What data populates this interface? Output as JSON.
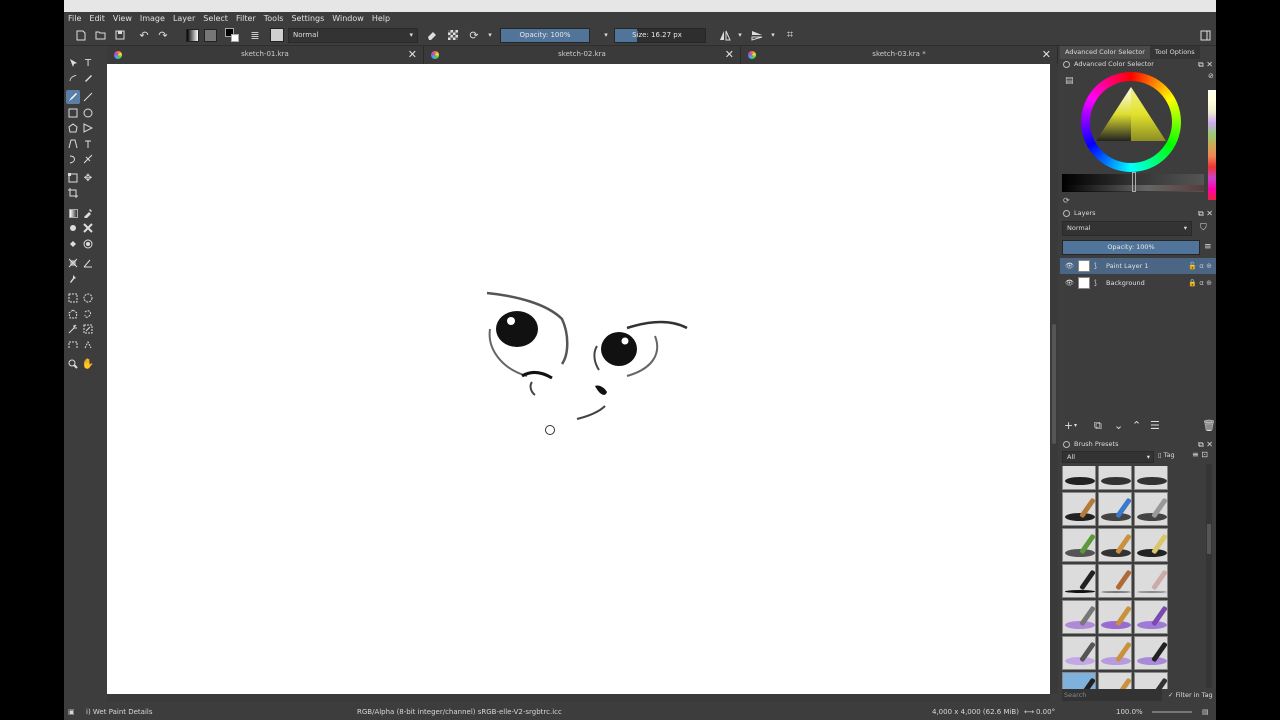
{
  "menu": [
    "File",
    "Edit",
    "View",
    "Image",
    "Layer",
    "Select",
    "Filter",
    "Tools",
    "Settings",
    "Window",
    "Help"
  ],
  "toolbar": {
    "blend_mode": "Normal",
    "opacity_label": "Opacity: 100%",
    "opacity_value": 1.0,
    "size_label": "Size: 16.27 px"
  },
  "tabs": [
    {
      "label": "sketch-01.kra",
      "close": "✕"
    },
    {
      "label": "sketch-02.kra",
      "close": "✕"
    },
    {
      "label": "sketch-03.kra *",
      "close": "✕"
    }
  ],
  "docker": {
    "tab_color": "Advanced Color Selector",
    "tab_tool": "Tool Options",
    "color_title": "Advanced Color Selector",
    "layers_title": "Layers",
    "layers_blend": "Normal",
    "layers_opacity": "Opacity:  100%",
    "layers": [
      {
        "name": "Paint Layer 1",
        "selected": true
      },
      {
        "name": "Background",
        "selected": false
      }
    ],
    "brush_title": "Brush Presets",
    "brush_filter": "All",
    "brush_tag": "Tag",
    "search_placeholder": "Search",
    "filter_in_tag": "Filter in Tag"
  },
  "status": {
    "brush": "i) Wet Paint Details",
    "colorspace": "RGB/Alpha (8-bit integer/channel)  sRGB-elle-V2-srgbtrc.icc",
    "size": "4,000 x 4,000 (62.6 MiB)",
    "rotation": "0.00°",
    "zoom": "100.0%"
  },
  "colors": {
    "accent": "#51749a",
    "panel": "#3d3d3d",
    "layer_selected": "#4b6584"
  }
}
